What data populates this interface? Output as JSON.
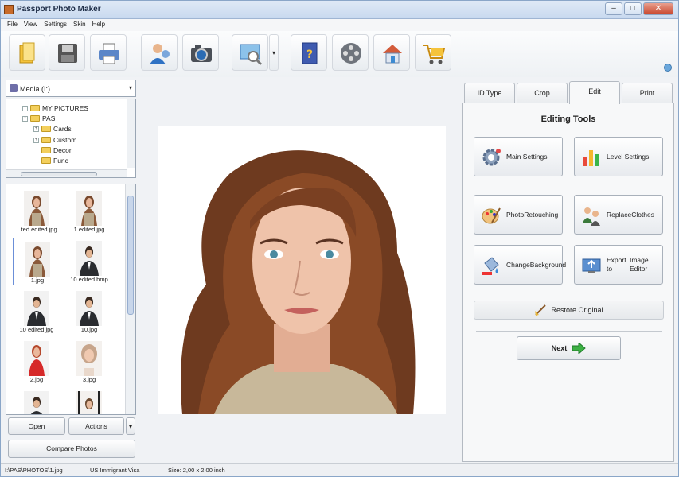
{
  "window": {
    "title": "Passport Photo Maker",
    "buttons": [
      "–",
      "□",
      "✕"
    ]
  },
  "menu": [
    "File",
    "View",
    "Settings",
    "Skin",
    "Help"
  ],
  "toolbar": {
    "buttons": [
      "open-folder-icon",
      "save-icon",
      "print-icon",
      "users-icon",
      "camera-icon",
      "image-search-icon",
      "help-book-icon",
      "film-reel-icon",
      "home-icon",
      "shopping-cart-icon"
    ],
    "dropdown_arrow": "▾"
  },
  "drive": {
    "label": "Media (I:)",
    "arrow": "▾"
  },
  "tree": {
    "items": [
      {
        "label": "MY PICTURES",
        "toggle": "+"
      },
      {
        "label": "PAS",
        "toggle": "−"
      },
      {
        "label": "Cards",
        "toggle": "+"
      },
      {
        "label": "Custom",
        "toggle": "+"
      },
      {
        "label": "Decor",
        "toggle": ""
      },
      {
        "label": "Func",
        "toggle": ""
      }
    ]
  },
  "thumbnails": [
    {
      "label": "...ted edited.jpg"
    },
    {
      "label": "1 edited.jpg"
    },
    {
      "label": "1.jpg"
    },
    {
      "label": "10 edited.bmp"
    },
    {
      "label": "10 edited.jpg"
    },
    {
      "label": "10.jpg"
    },
    {
      "label": "2.jpg"
    },
    {
      "label": "3.jpg"
    },
    {
      "label": ""
    },
    {
      "label": ""
    }
  ],
  "left_buttons": {
    "open": "Open",
    "actions": "Actions",
    "actions_arrow": "▾",
    "compare": "Compare Photos"
  },
  "tabs": [
    "ID Type",
    "Crop",
    "Edit",
    "Print"
  ],
  "editing": {
    "title": "Editing Tools",
    "tools": [
      {
        "label1": "Main Settings",
        "label2": ""
      },
      {
        "label1": "Level Settings",
        "label2": ""
      },
      {
        "label1": "Photo",
        "label2": "Retouching"
      },
      {
        "label1": "Replace",
        "label2": "Clothes"
      },
      {
        "label1": "Change",
        "label2": "Background"
      },
      {
        "label1": "Export to",
        "label2": "Image Editor"
      }
    ],
    "restore": "Restore Original",
    "next": "Next"
  },
  "status": {
    "path": "I:\\PAS\\PHOTOS\\1.jpg",
    "format": "US Immigrant Visa",
    "size": "Size: 2,00 x 2,00 inch"
  },
  "colors": {
    "accent": "#6b8fd8",
    "next_arrow": "#3cb043"
  }
}
